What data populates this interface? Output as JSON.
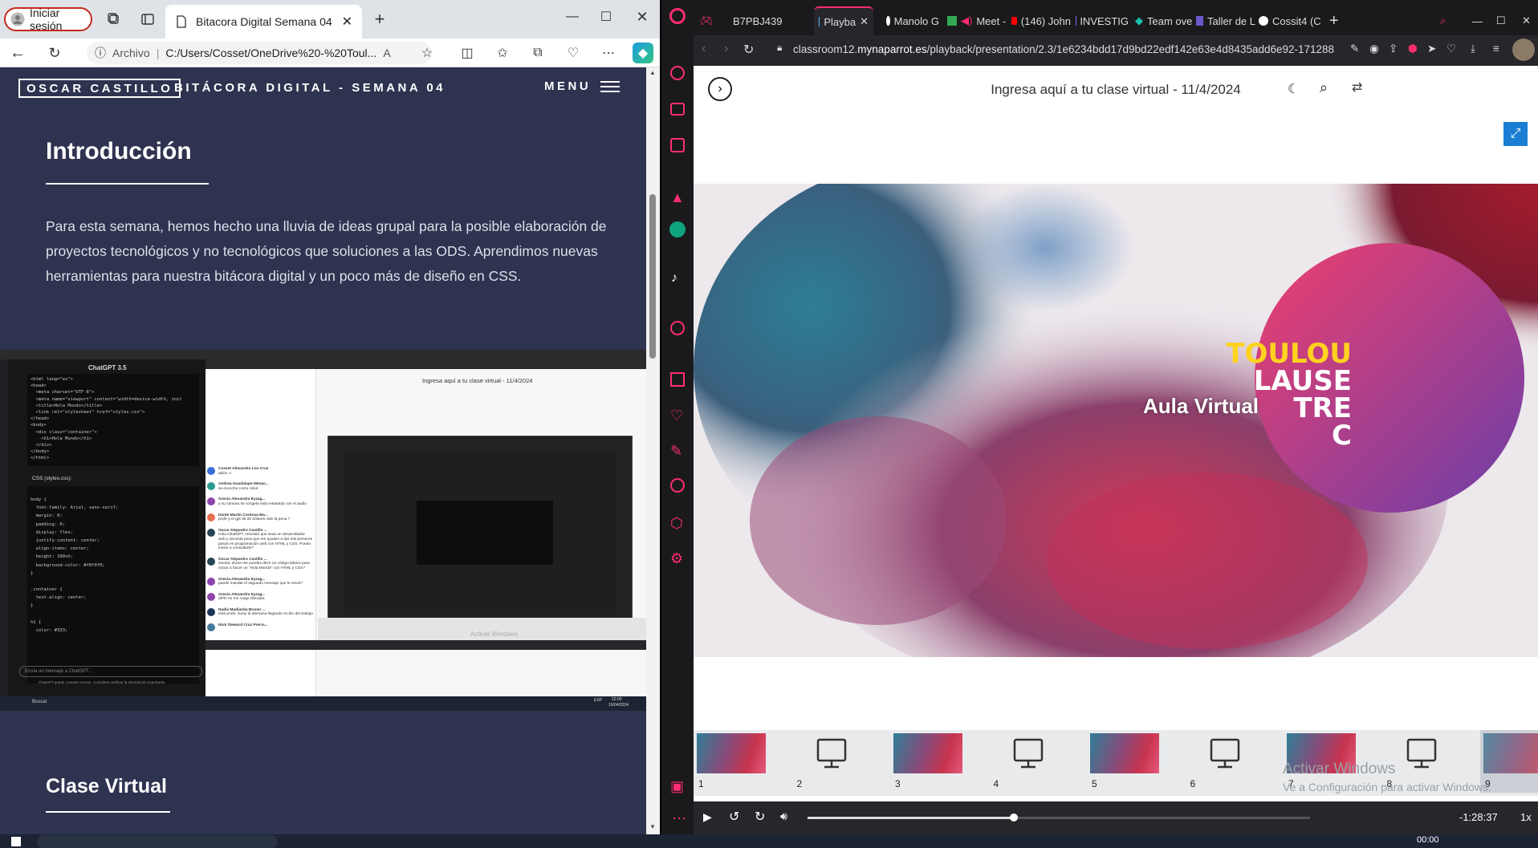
{
  "edge": {
    "signin_label": "Iniciar sesión",
    "tab_title": "Bitacora Digital Semana 04",
    "file_label": "Archivo",
    "url": "C:/Users/Cosset/OneDrive%20-%20Toul..."
  },
  "site": {
    "brand": "OSCAR CASTILLO",
    "subtitle": "BITÁCORA DIGITAL - SEMANA 04",
    "menu_label": "MENU",
    "intro_title": "Introducción",
    "intro_text": "Para esta semana, hemos hecho una lluvia de ideas grupal para la posible elaboración de proyectos tecnológicos y no tecnológicos que soluciones a las ODS. Aprendimos nuevas herramientas para nuestra bitácora digital y un poco más de diseño en CSS.",
    "clase_title": "Clase Virtual",
    "screenshot": {
      "chat_title": "ChatGPT 3.5",
      "code_lines": [
        "<html lang=\"es\">",
        "<head>",
        "  <meta charset=\"UTF-8\">",
        "  <meta name=\"viewport\" content=\"width=device-width, init",
        "  <title>Hola Mundo</title>",
        "  <link rel=\"stylesheet\" href=\"styles.css\">",
        "</head>",
        "<body>",
        "  <div class=\"container\">",
        "    <h1>Hola Mundo</h1>",
        "  </div>",
        "</body>",
        "</html>"
      ],
      "css_label": "CSS (styles.css):",
      "css_lines": [
        "body {",
        "  font-family: Arial, sans-serif;",
        "  margin: 0;",
        "  padding: 0;",
        "  display: flex;",
        "  justify-content: center;",
        "  align-items: center;",
        "  height: 100vh;",
        "  background-color: #f0f0f0;",
        "}",
        "",
        ".container {",
        "  text-align: center;",
        "}",
        "",
        "h1 {",
        "  color: #333;"
      ],
      "chat_placeholder": "Envía un mensaje a ChatGPT...",
      "chat_disclaimer": "ChatGPT puede cometer errores. Considera verificar la información importante.",
      "inner_title": "Ingresa aquí a tu clase virtual - 11/4/2024",
      "chat_names": [
        "Cosset Alexandra Loo Cruz",
        "Andrea Guadalupe Menac...",
        "Grecia Alexandra Eyzag...",
        "Dante Martín Cordova Ma...",
        "Oscar Alejandro Castillo ...",
        "Oscar Alejandro Castillo ...",
        "Grecia Alexandra Eyzag...",
        "Grecia Alexandra Eyzag...",
        "Nadia Madianita Bruner ...",
        "Nick Steward Cruz Precis..."
      ],
      "chat_msgs": [
        "adios :c",
        "se escucha como robot",
        "y su cámara se congela está retrasado con el audio",
        "profe y el gpt de 20 dólares vale la pena ?",
        "Hola ChatGPT, necesito que seas un desarrollador web y docente para que me ayudes a dar mis primeros pasos en programación web con HTML y CSS. Puedo iniciar a consultarte?",
        "Genial, ahora me puedes decir un código básico para iniciar a hacer un \"Hola Mundo\" con HTML y CSS?",
        "puede mandar el segundo mensaje que le envió?",
        "ahhh no me cargo disculpa",
        "está profe, sumy la alemana llegando recién del trabajo",
        ""
      ],
      "watermark": "Activar Windows",
      "search": "Buscar",
      "time": "22:00",
      "date": "10/04/2024",
      "lang": "ESP"
    }
  },
  "opera": {
    "tabs": [
      "B7PBJ439",
      "Playba",
      "Manolo G",
      "Meet -",
      "(146) John",
      "INVESTIG",
      "Team ove",
      "Taller de L",
      "Cossit4 (C"
    ],
    "url_host": "classroom12.",
    "url_domain": "mynaparrot.es",
    "url_path": "/playback/presentation/2.3/1e6234bdd17d9bd22edf142e63e4d8435add6e92-171288"
  },
  "player": {
    "title": "Ingresa aquí a tu clase virtual - 11/4/2024",
    "slide_text": "Aula Virtual",
    "logo_lines": [
      "TOULOU",
      "LAUSE",
      "TRE",
      "C"
    ],
    "thumb_numbers": [
      "1",
      "2",
      "3",
      "4",
      "5",
      "6",
      "7",
      "8",
      "9"
    ],
    "watermark_title": "Activar Windows",
    "watermark_sub": "Ve a Configuración para activar Windows.",
    "time_remaining": "-1:28:37",
    "speed": "1x",
    "progress": 0.41
  },
  "taskbar": {
    "time": "00:00"
  },
  "colors": {
    "site_bg": "#2e3350",
    "opera_accent": "#ff2d6f",
    "logo_yellow": "#ffd21f",
    "player_link": "#1a7fd4"
  }
}
